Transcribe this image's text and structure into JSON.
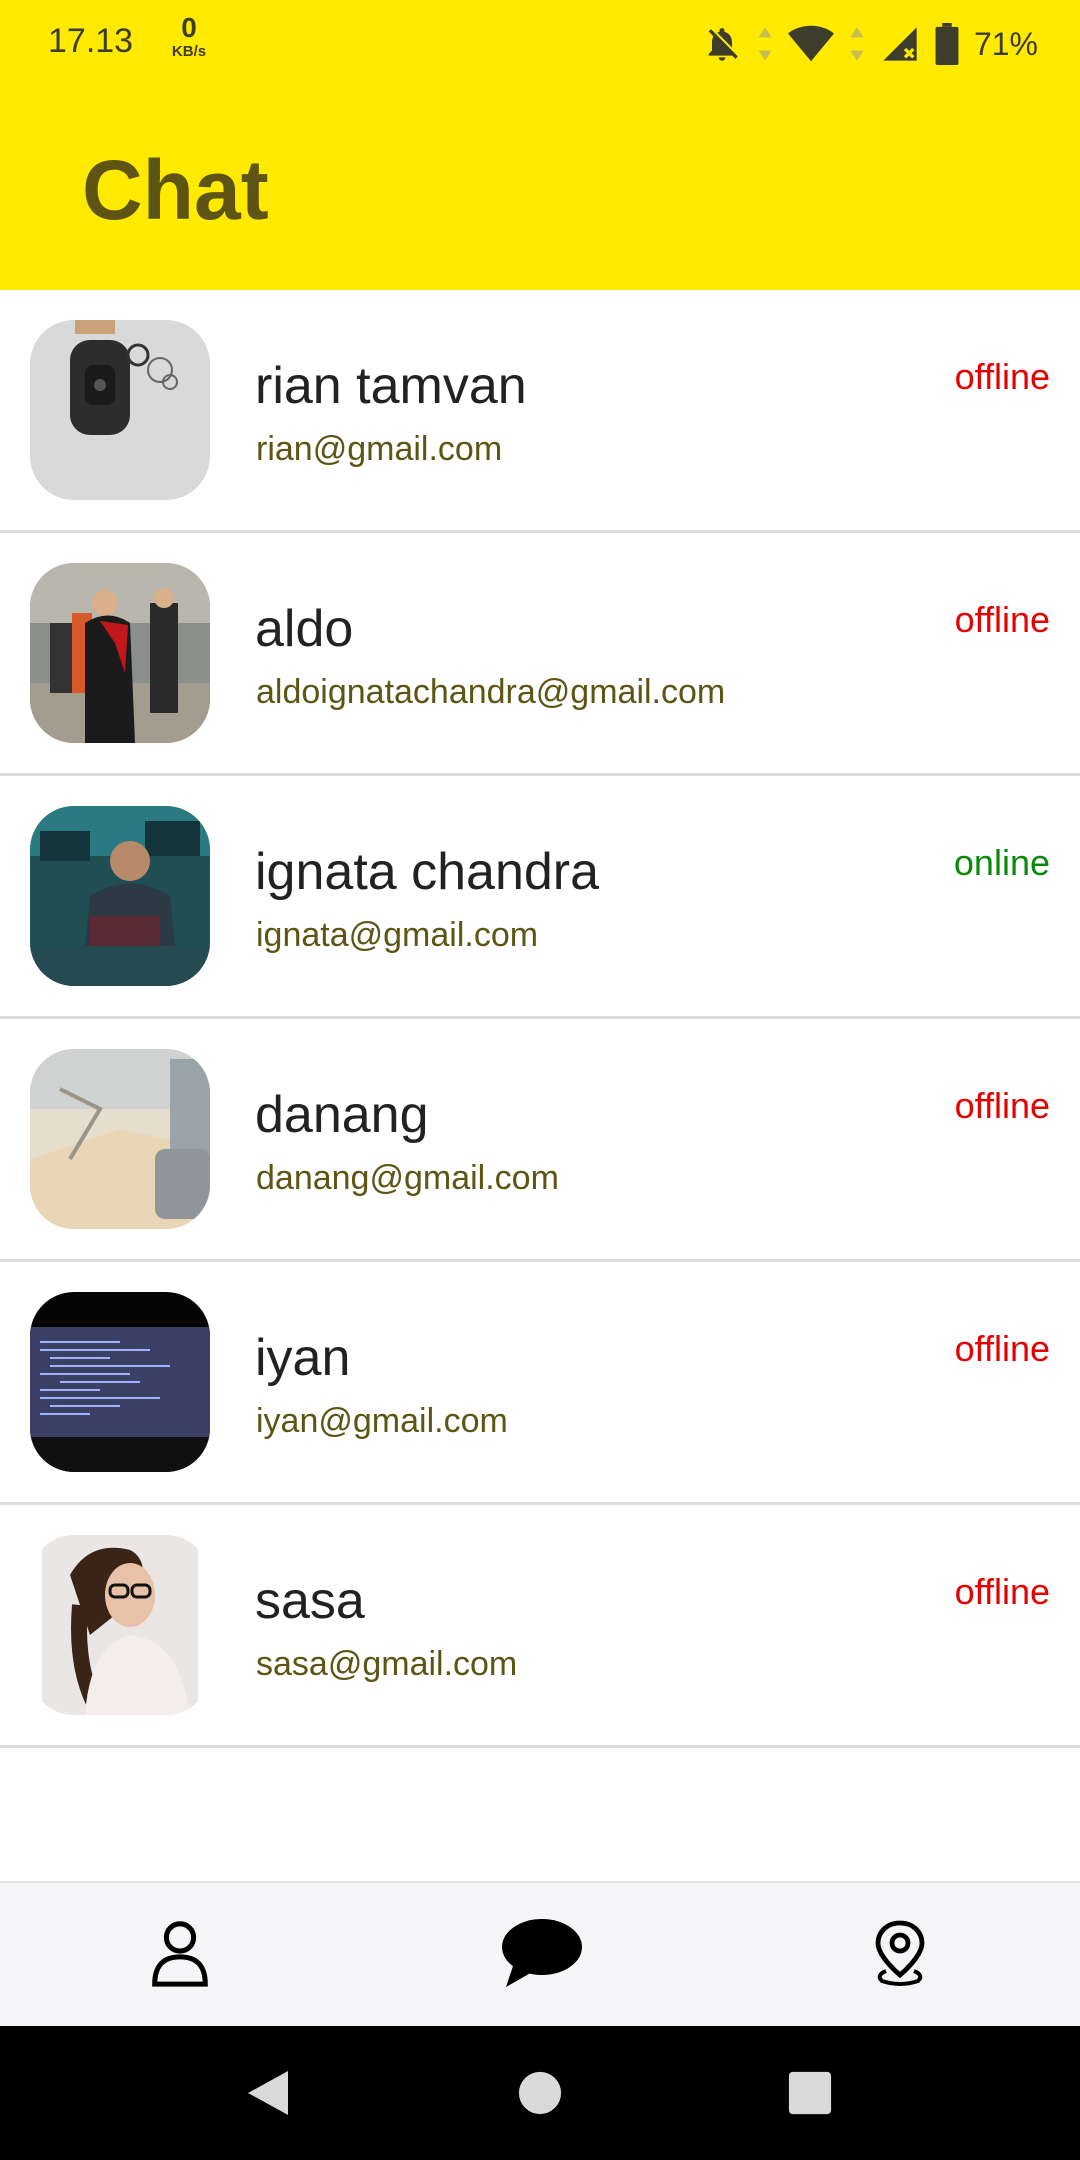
{
  "status_bar": {
    "time": "17.13",
    "net_speed_value": "0",
    "net_speed_unit": "KB/s",
    "battery": "71%",
    "icons": [
      "bell-off-icon",
      "data-arrows-icon",
      "wifi-icon",
      "signal-icon",
      "battery-icon"
    ]
  },
  "app_bar": {
    "title": "Chat"
  },
  "contacts": [
    {
      "name": "rian tamvan",
      "email": "rian@gmail.com",
      "status": "offline"
    },
    {
      "name": "aldo",
      "email": "aldoignatachandra@gmail.com",
      "status": "offline"
    },
    {
      "name": "ignata chandra",
      "email": "ignata@gmail.com",
      "status": "online"
    },
    {
      "name": "danang",
      "email": "danang@gmail.com",
      "status": "offline"
    },
    {
      "name": "iyan",
      "email": "iyan@gmail.com",
      "status": "offline"
    },
    {
      "name": "sasa",
      "email": "sasa@gmail.com",
      "status": "offline"
    }
  ],
  "bottom_nav": {
    "items": [
      {
        "icon": "person-icon"
      },
      {
        "icon": "chat-bubble-icon"
      },
      {
        "icon": "location-pin-icon"
      }
    ]
  },
  "system_nav": {
    "icons": [
      "back-icon",
      "home-icon",
      "recents-icon"
    ]
  },
  "colors": {
    "accent": "#ffea00",
    "title": "#5e5515",
    "offline": "#e60000",
    "online": "#0a8a0a"
  }
}
